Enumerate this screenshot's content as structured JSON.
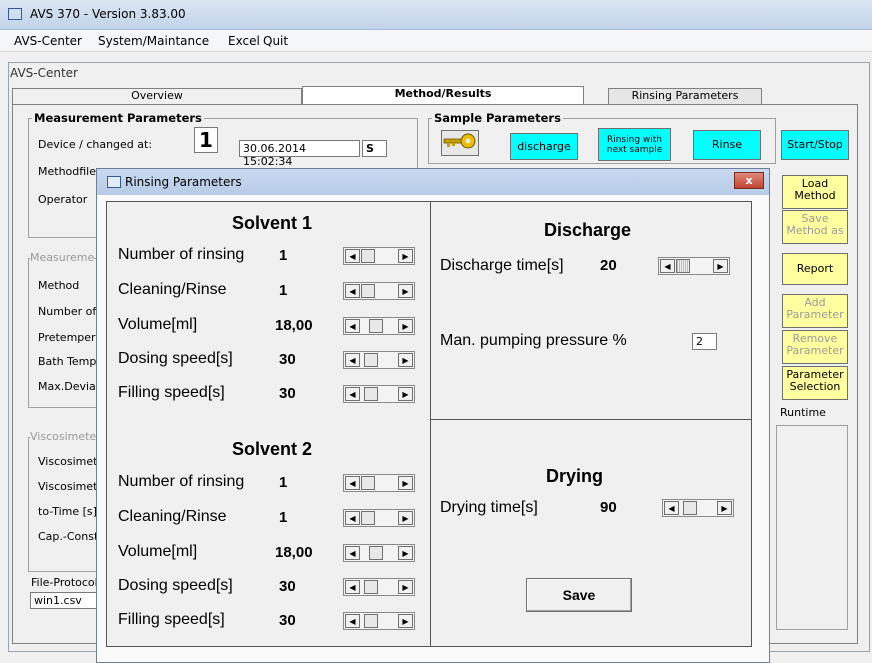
{
  "window": {
    "title": "AVS 370 - Version 3.83.00"
  },
  "menu": [
    "AVS-Center",
    "System/Maintance",
    "Excel",
    "Quit"
  ],
  "frame_title": "AVS-Center",
  "tabs": [
    "Overview",
    "Method/Results",
    "Rinsing Parameters"
  ],
  "measurement": {
    "title": "Measurement Parameters",
    "device_label": "Device / changed at:",
    "device_number": "1",
    "changed_at": "30.06.2014 15:02:34",
    "s_flag": "S",
    "methodfile_label": "Methodfile:",
    "operator_label": "Operator"
  },
  "left_labels": {
    "measure_group": "Measureme",
    "method": "Method",
    "number_of": "Number of",
    "pretempering": "Pretemperin",
    "bath_temp": "Bath Temp",
    "max_deviation": "Max.Deviat",
    "viscosimeter_group": "Viscosimete",
    "visc1": "Viscosimete",
    "visc2": "Viscosimete",
    "to_time": "to-Time [s]",
    "cap_const": "Cap.-Const",
    "file_protocol": "File-Protocol",
    "file_value": "win1.csv"
  },
  "sample": {
    "title": "Sample Parameters",
    "discharge": "discharge",
    "rinsing_with": "Rinsing with",
    "next_sample": "next sample",
    "rinse": "Rinse",
    "start_stop": "Start/Stop"
  },
  "side_buttons": {
    "load_1": "Load",
    "load_2": "Method",
    "save_1": "Save",
    "save_2": "Method as",
    "report": "Report",
    "add_1": "Add",
    "add_2": "Parameter",
    "remove_1": "Remove",
    "remove_2": "Parameter",
    "psel_1": "Parameter",
    "psel_2": "Selection",
    "runtime": "Runtime"
  },
  "dialog": {
    "title": "Rinsing Parameters",
    "close": "x",
    "solvent1": {
      "heading": "Solvent 1",
      "rows": [
        {
          "label": "Number of rinsing",
          "value": "1"
        },
        {
          "label": "Cleaning/Rinse",
          "value": "1"
        },
        {
          "label": "Volume[ml]",
          "value": "18,00"
        },
        {
          "label": "Dosing speed[s]",
          "value": "30"
        },
        {
          "label": "Filling speed[s]",
          "value": "30"
        }
      ]
    },
    "solvent2": {
      "heading": "Solvent 2",
      "rows": [
        {
          "label": "Number of rinsing",
          "value": "1"
        },
        {
          "label": "Cleaning/Rinse",
          "value": "1"
        },
        {
          "label": "Volume[ml]",
          "value": "18,00"
        },
        {
          "label": "Dosing speed[s]",
          "value": "30"
        },
        {
          "label": "Filling speed[s]",
          "value": "30"
        }
      ]
    },
    "discharge": {
      "heading": "Discharge",
      "time_label": "Discharge time[s]",
      "time_value": "20",
      "pressure_label": "Man. pumping pressure %",
      "pressure_value": "2"
    },
    "drying": {
      "heading": "Drying",
      "time_label": "Drying time[s]",
      "time_value": "90"
    },
    "save": "Save"
  }
}
